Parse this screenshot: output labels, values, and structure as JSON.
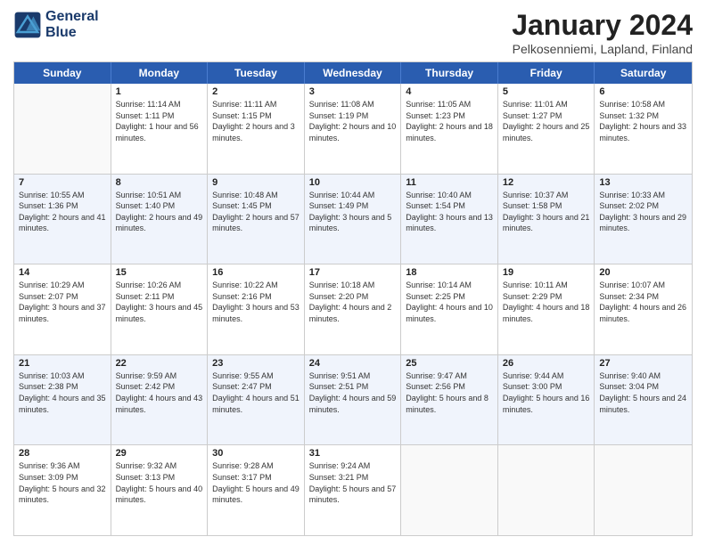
{
  "header": {
    "logo_line1": "General",
    "logo_line2": "Blue",
    "title": "January 2024",
    "subtitle": "Pelkosenniemi, Lapland, Finland"
  },
  "weekdays": [
    "Sunday",
    "Monday",
    "Tuesday",
    "Wednesday",
    "Thursday",
    "Friday",
    "Saturday"
  ],
  "rows": [
    [
      {
        "day": "",
        "sunrise": "",
        "sunset": "",
        "daylight": ""
      },
      {
        "day": "1",
        "sunrise": "Sunrise: 11:14 AM",
        "sunset": "Sunset: 1:11 PM",
        "daylight": "Daylight: 1 hour and 56 minutes."
      },
      {
        "day": "2",
        "sunrise": "Sunrise: 11:11 AM",
        "sunset": "Sunset: 1:15 PM",
        "daylight": "Daylight: 2 hours and 3 minutes."
      },
      {
        "day": "3",
        "sunrise": "Sunrise: 11:08 AM",
        "sunset": "Sunset: 1:19 PM",
        "daylight": "Daylight: 2 hours and 10 minutes."
      },
      {
        "day": "4",
        "sunrise": "Sunrise: 11:05 AM",
        "sunset": "Sunset: 1:23 PM",
        "daylight": "Daylight: 2 hours and 18 minutes."
      },
      {
        "day": "5",
        "sunrise": "Sunrise: 11:01 AM",
        "sunset": "Sunset: 1:27 PM",
        "daylight": "Daylight: 2 hours and 25 minutes."
      },
      {
        "day": "6",
        "sunrise": "Sunrise: 10:58 AM",
        "sunset": "Sunset: 1:32 PM",
        "daylight": "Daylight: 2 hours and 33 minutes."
      }
    ],
    [
      {
        "day": "7",
        "sunrise": "Sunrise: 10:55 AM",
        "sunset": "Sunset: 1:36 PM",
        "daylight": "Daylight: 2 hours and 41 minutes."
      },
      {
        "day": "8",
        "sunrise": "Sunrise: 10:51 AM",
        "sunset": "Sunset: 1:40 PM",
        "daylight": "Daylight: 2 hours and 49 minutes."
      },
      {
        "day": "9",
        "sunrise": "Sunrise: 10:48 AM",
        "sunset": "Sunset: 1:45 PM",
        "daylight": "Daylight: 2 hours and 57 minutes."
      },
      {
        "day": "10",
        "sunrise": "Sunrise: 10:44 AM",
        "sunset": "Sunset: 1:49 PM",
        "daylight": "Daylight: 3 hours and 5 minutes."
      },
      {
        "day": "11",
        "sunrise": "Sunrise: 10:40 AM",
        "sunset": "Sunset: 1:54 PM",
        "daylight": "Daylight: 3 hours and 13 minutes."
      },
      {
        "day": "12",
        "sunrise": "Sunrise: 10:37 AM",
        "sunset": "Sunset: 1:58 PM",
        "daylight": "Daylight: 3 hours and 21 minutes."
      },
      {
        "day": "13",
        "sunrise": "Sunrise: 10:33 AM",
        "sunset": "Sunset: 2:02 PM",
        "daylight": "Daylight: 3 hours and 29 minutes."
      }
    ],
    [
      {
        "day": "14",
        "sunrise": "Sunrise: 10:29 AM",
        "sunset": "Sunset: 2:07 PM",
        "daylight": "Daylight: 3 hours and 37 minutes."
      },
      {
        "day": "15",
        "sunrise": "Sunrise: 10:26 AM",
        "sunset": "Sunset: 2:11 PM",
        "daylight": "Daylight: 3 hours and 45 minutes."
      },
      {
        "day": "16",
        "sunrise": "Sunrise: 10:22 AM",
        "sunset": "Sunset: 2:16 PM",
        "daylight": "Daylight: 3 hours and 53 minutes."
      },
      {
        "day": "17",
        "sunrise": "Sunrise: 10:18 AM",
        "sunset": "Sunset: 2:20 PM",
        "daylight": "Daylight: 4 hours and 2 minutes."
      },
      {
        "day": "18",
        "sunrise": "Sunrise: 10:14 AM",
        "sunset": "Sunset: 2:25 PM",
        "daylight": "Daylight: 4 hours and 10 minutes."
      },
      {
        "day": "19",
        "sunrise": "Sunrise: 10:11 AM",
        "sunset": "Sunset: 2:29 PM",
        "daylight": "Daylight: 4 hours and 18 minutes."
      },
      {
        "day": "20",
        "sunrise": "Sunrise: 10:07 AM",
        "sunset": "Sunset: 2:34 PM",
        "daylight": "Daylight: 4 hours and 26 minutes."
      }
    ],
    [
      {
        "day": "21",
        "sunrise": "Sunrise: 10:03 AM",
        "sunset": "Sunset: 2:38 PM",
        "daylight": "Daylight: 4 hours and 35 minutes."
      },
      {
        "day": "22",
        "sunrise": "Sunrise: 9:59 AM",
        "sunset": "Sunset: 2:42 PM",
        "daylight": "Daylight: 4 hours and 43 minutes."
      },
      {
        "day": "23",
        "sunrise": "Sunrise: 9:55 AM",
        "sunset": "Sunset: 2:47 PM",
        "daylight": "Daylight: 4 hours and 51 minutes."
      },
      {
        "day": "24",
        "sunrise": "Sunrise: 9:51 AM",
        "sunset": "Sunset: 2:51 PM",
        "daylight": "Daylight: 4 hours and 59 minutes."
      },
      {
        "day": "25",
        "sunrise": "Sunrise: 9:47 AM",
        "sunset": "Sunset: 2:56 PM",
        "daylight": "Daylight: 5 hours and 8 minutes."
      },
      {
        "day": "26",
        "sunrise": "Sunrise: 9:44 AM",
        "sunset": "Sunset: 3:00 PM",
        "daylight": "Daylight: 5 hours and 16 minutes."
      },
      {
        "day": "27",
        "sunrise": "Sunrise: 9:40 AM",
        "sunset": "Sunset: 3:04 PM",
        "daylight": "Daylight: 5 hours and 24 minutes."
      }
    ],
    [
      {
        "day": "28",
        "sunrise": "Sunrise: 9:36 AM",
        "sunset": "Sunset: 3:09 PM",
        "daylight": "Daylight: 5 hours and 32 minutes."
      },
      {
        "day": "29",
        "sunrise": "Sunrise: 9:32 AM",
        "sunset": "Sunset: 3:13 PM",
        "daylight": "Daylight: 5 hours and 40 minutes."
      },
      {
        "day": "30",
        "sunrise": "Sunrise: 9:28 AM",
        "sunset": "Sunset: 3:17 PM",
        "daylight": "Daylight: 5 hours and 49 minutes."
      },
      {
        "day": "31",
        "sunrise": "Sunrise: 9:24 AM",
        "sunset": "Sunset: 3:21 PM",
        "daylight": "Daylight: 5 hours and 57 minutes."
      },
      {
        "day": "",
        "sunrise": "",
        "sunset": "",
        "daylight": ""
      },
      {
        "day": "",
        "sunrise": "",
        "sunset": "",
        "daylight": ""
      },
      {
        "day": "",
        "sunrise": "",
        "sunset": "",
        "daylight": ""
      }
    ]
  ]
}
